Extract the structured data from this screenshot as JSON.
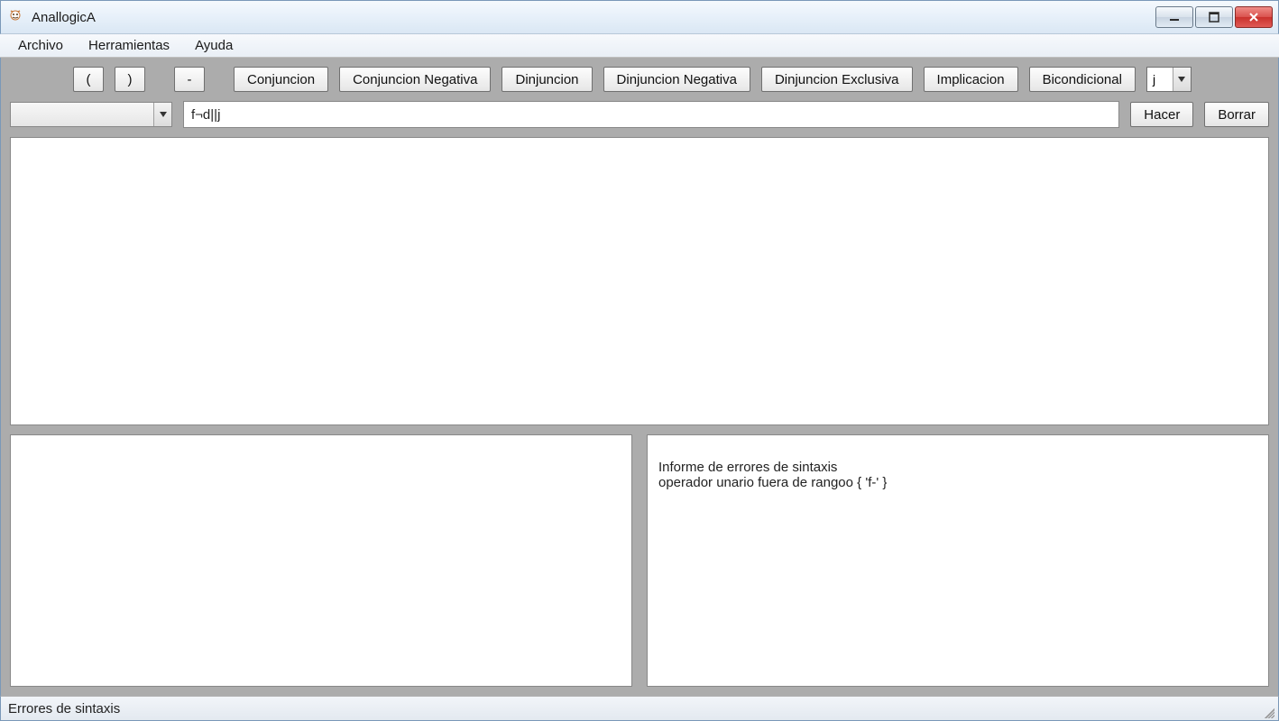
{
  "window": {
    "title": "AnallogicA",
    "buttons": {
      "minimize": "minimize",
      "maximize": "maximize",
      "close": "close"
    }
  },
  "menubar": {
    "items": [
      {
        "label": "Archivo"
      },
      {
        "label": "Herramientas"
      },
      {
        "label": "Ayuda"
      }
    ]
  },
  "toolbar": {
    "open_paren": "(",
    "close_paren": ")",
    "neg": "-",
    "ops": [
      "Conjuncion",
      "Conjuncion Negativa",
      "Dinjuncion",
      "Dinjuncion Negativa",
      "Dinjuncion Exclusiva",
      "Implicacion",
      "Bicondicional"
    ],
    "variable_selected": "j"
  },
  "formula_row": {
    "history_selected": "",
    "formula_value": "f¬d||j",
    "do_label": "Hacer",
    "clear_label": "Borrar"
  },
  "panels": {
    "main_content": "",
    "left_content": "",
    "right_content": "Informe de errores de sintaxis\noperador unario fuera de rangoo { 'f-' }"
  },
  "statusbar": {
    "text": "Errores de sintaxis"
  }
}
